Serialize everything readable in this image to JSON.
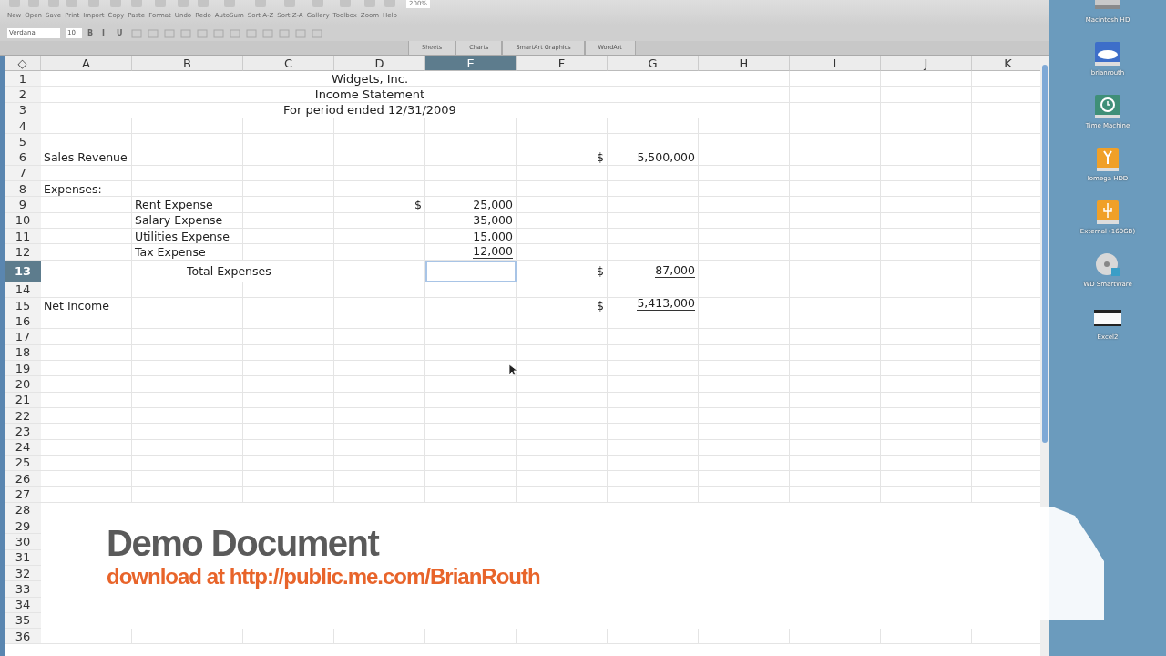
{
  "toolbar": {
    "buttons": [
      {
        "label": "New"
      },
      {
        "label": "Open"
      },
      {
        "label": "Save"
      },
      {
        "label": "Print"
      },
      {
        "label": "Import"
      },
      {
        "label": "Copy"
      },
      {
        "label": "Paste"
      },
      {
        "label": "Format"
      },
      {
        "label": "Undo"
      },
      {
        "label": "Redo"
      },
      {
        "label": "AutoSum"
      },
      {
        "label": "Sort A-Z"
      },
      {
        "label": "Sort Z-A"
      },
      {
        "label": "Gallery"
      },
      {
        "label": "Toolbox"
      },
      {
        "label": "Zoom"
      },
      {
        "label": "Help"
      }
    ],
    "zoom": "200%"
  },
  "format_bar": {
    "font": "Verdana",
    "size": "10",
    "styles": [
      "B",
      "I",
      "U"
    ]
  },
  "ribbon_tabs": [
    {
      "label": "Sheets",
      "selected": false
    },
    {
      "label": "Charts",
      "selected": false
    },
    {
      "label": "SmartArt Graphics",
      "selected": false
    },
    {
      "label": "WordArt",
      "selected": false
    }
  ],
  "corner": "◇",
  "columns": [
    {
      "label": "A",
      "selected": false
    },
    {
      "label": "B",
      "selected": false
    },
    {
      "label": "C",
      "selected": false
    },
    {
      "label": "D",
      "selected": false
    },
    {
      "label": "E",
      "selected": true
    },
    {
      "label": "F",
      "selected": false
    },
    {
      "label": "G",
      "selected": false
    },
    {
      "label": "H",
      "selected": false
    },
    {
      "label": "I",
      "selected": false
    },
    {
      "label": "J",
      "selected": false
    },
    {
      "label": "K",
      "selected": false
    }
  ],
  "rows": [
    {
      "number": "1",
      "selected": false,
      "heading": "Widgets, Inc."
    },
    {
      "number": "2",
      "selected": false,
      "heading": "Income Statement"
    },
    {
      "number": "3",
      "selected": false,
      "heading": "For period ended 12/31/2009"
    },
    {
      "number": "4",
      "selected": false
    },
    {
      "number": "5",
      "selected": false
    },
    {
      "number": "6",
      "selected": false,
      "cells": [
        {
          "kind": "label",
          "text": "Sales Revenue"
        },
        {},
        {},
        {},
        {},
        {
          "kind": "currency",
          "text": "$"
        },
        {
          "kind": "amount",
          "text": "5,500,000"
        }
      ]
    },
    {
      "number": "7",
      "selected": false
    },
    {
      "number": "8",
      "selected": false,
      "cells": [
        {
          "kind": "label",
          "text": "Expenses:"
        }
      ]
    },
    {
      "number": "9",
      "selected": false,
      "cells": [
        {},
        {
          "kind": "label",
          "text": "Rent Expense"
        },
        {},
        {
          "kind": "currency",
          "text": "$"
        },
        {
          "kind": "amount",
          "text": "25,000"
        }
      ]
    },
    {
      "number": "10",
      "selected": false,
      "cells": [
        {},
        {
          "kind": "label",
          "text": "Salary Expense"
        },
        {},
        {},
        {
          "kind": "amount",
          "text": "35,000"
        }
      ]
    },
    {
      "number": "11",
      "selected": false,
      "cells": [
        {},
        {
          "kind": "label",
          "text": "Utilities Expense"
        },
        {},
        {},
        {
          "kind": "amount",
          "text": "15,000"
        }
      ]
    },
    {
      "number": "12",
      "selected": false,
      "cells": [
        {},
        {
          "kind": "label",
          "text": "Tax Expense"
        },
        {},
        {},
        {
          "kind": "amount",
          "text": "12,000",
          "underlined": true,
          "double": false
        }
      ]
    },
    {
      "number": "13",
      "selected": true,
      "cells": [
        {},
        {
          "kind": "total",
          "text": "Total Expenses"
        },
        {},
        {},
        {},
        {
          "kind": "currency",
          "text": "$"
        },
        {
          "kind": "amount",
          "text": "87,000",
          "underlined": true,
          "double": false
        }
      ]
    },
    {
      "number": "14",
      "selected": false
    },
    {
      "number": "15",
      "selected": false,
      "cells": [
        {
          "kind": "label",
          "text": "Net Income"
        },
        {},
        {},
        {},
        {},
        {
          "kind": "currency",
          "text": "$"
        },
        {
          "kind": "amount",
          "text": "5,413,000",
          "underlined": true,
          "double": true
        }
      ]
    },
    {
      "number": "16",
      "selected": false
    },
    {
      "number": "17",
      "selected": false
    },
    {
      "number": "18",
      "selected": false
    },
    {
      "number": "19",
      "selected": false
    },
    {
      "number": "20",
      "selected": false
    },
    {
      "number": "21",
      "selected": false
    },
    {
      "number": "22",
      "selected": false
    },
    {
      "number": "23",
      "selected": false
    },
    {
      "number": "24",
      "selected": false
    },
    {
      "number": "25",
      "selected": false
    },
    {
      "number": "26",
      "selected": false
    },
    {
      "number": "27",
      "selected": false
    },
    {
      "number": "28",
      "selected": false
    },
    {
      "number": "29",
      "selected": false
    },
    {
      "number": "30",
      "selected": false
    },
    {
      "number": "31",
      "selected": false
    },
    {
      "number": "32",
      "selected": false
    },
    {
      "number": "33",
      "selected": false
    },
    {
      "number": "34",
      "selected": false
    },
    {
      "number": "35",
      "selected": false
    },
    {
      "number": "36",
      "selected": false
    }
  ],
  "desktop_icons": [
    {
      "kind": "drive",
      "label": "Macintosh HD"
    },
    {
      "kind": "cloud",
      "label": "brianrouth"
    },
    {
      "kind": "clock",
      "label": "Time Machine"
    },
    {
      "kind": "orange",
      "label": "Iomega HDD"
    },
    {
      "kind": "usb",
      "label": "External (160GB)"
    },
    {
      "kind": "disc",
      "label": "WD SmartWare"
    },
    {
      "kind": "window",
      "label": "Excel2"
    }
  ],
  "banner": {
    "title": "Demo Document",
    "subtitle": "download at http://public.me.com/BrianRouth"
  }
}
